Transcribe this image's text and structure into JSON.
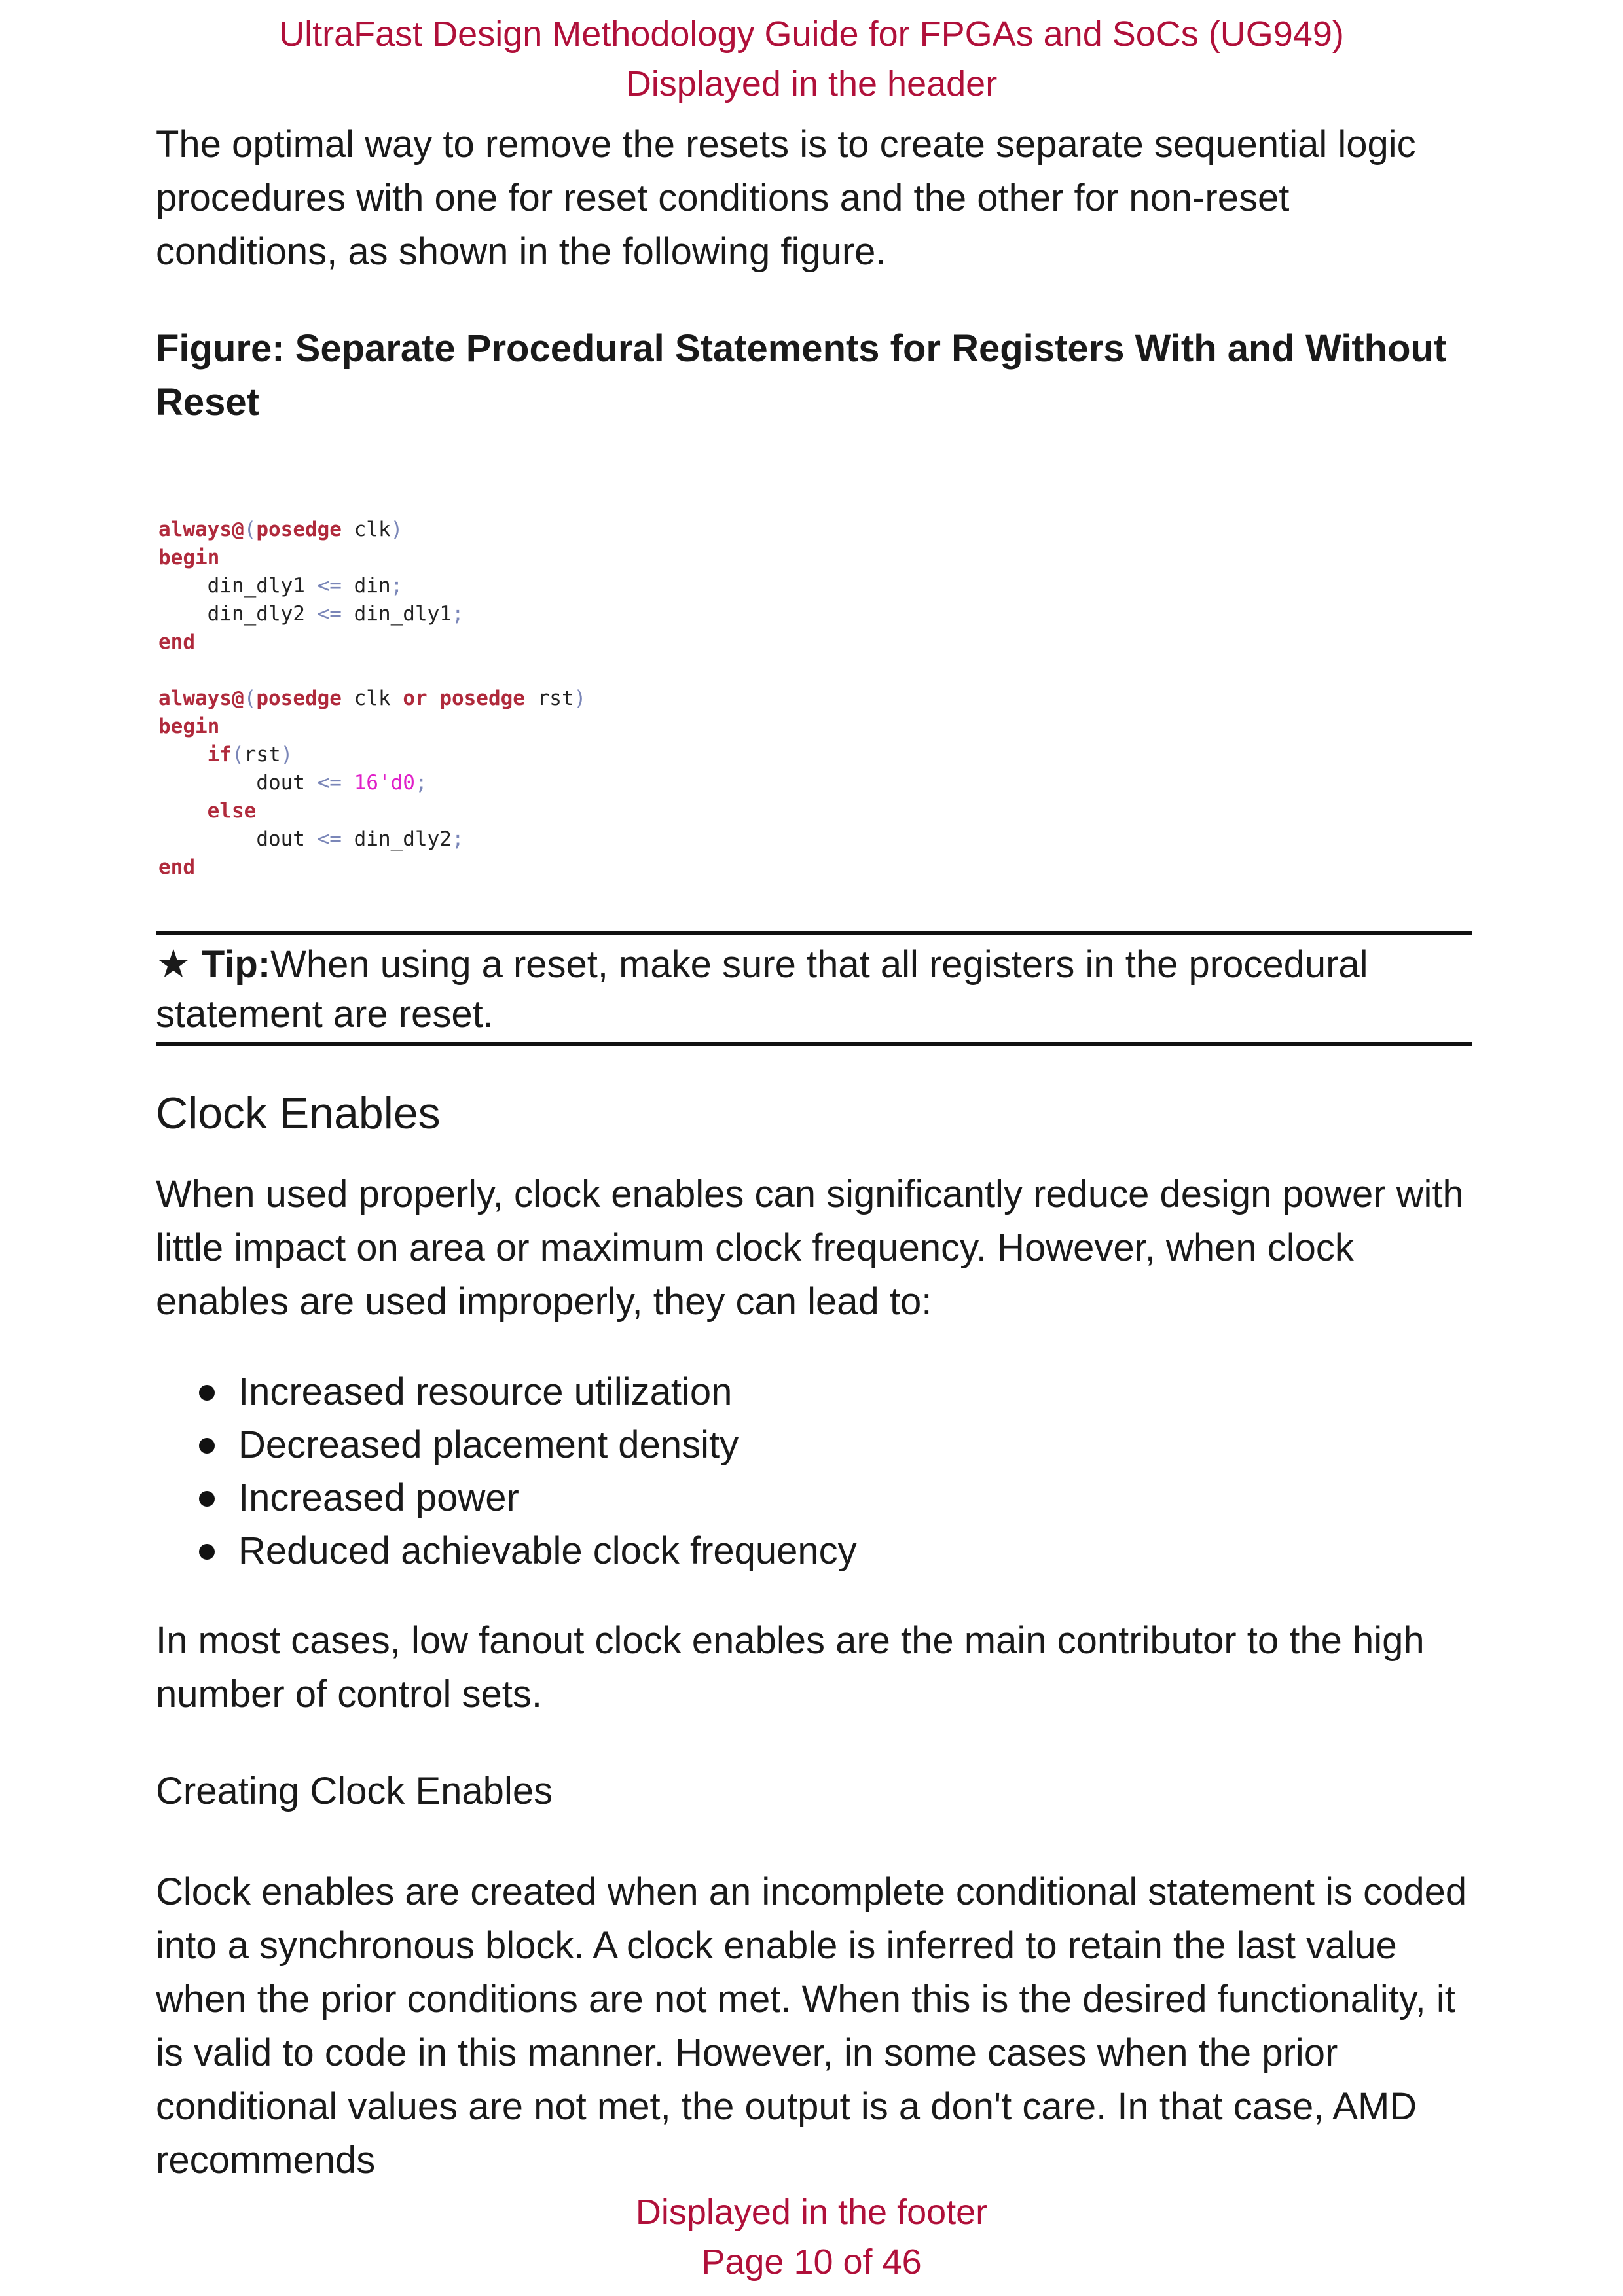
{
  "header": {
    "title": "UltraFast Design Methodology Guide for FPGAs and SoCs (UG949)",
    "subtitle": "Displayed in the header"
  },
  "intro_paragraph": "The optimal way to remove the resets is to create separate sequential logic procedures with one for reset conditions and the other for non-reset conditions, as shown in the following figure.",
  "figure": {
    "title": "Figure: Separate Procedural Statements for Registers With and Without Reset",
    "code": {
      "block1_line1_kw": "always@",
      "block1_line1_paren_open": "(",
      "block1_line1_posedge": "posedge",
      "block1_line1_sig": " clk",
      "block1_line1_paren_close": ")",
      "begin": "begin",
      "b1_assign1_lhs": "din_dly1",
      "b1_assign1_rhs": "din",
      "b1_assign2_lhs": "din_dly2",
      "b1_assign2_rhs": "din_dly1",
      "end": "end",
      "block2_sig1": " clk ",
      "block2_or": "or",
      "block2_sig2": " rst",
      "if_kw": "if",
      "if_cond": "rst",
      "dout": "dout",
      "reset_val": "16'd0",
      "else_kw": "else",
      "else_rhs": "din_dly2",
      "assign_op": "<=",
      "semicolon": ";"
    }
  },
  "tip": {
    "star": "★",
    "label": "Tip:",
    "text": "When using a reset, make sure that all registers in the procedural statement are reset."
  },
  "clock_enables": {
    "heading": "Clock Enables",
    "paragraph": "When used properly, clock enables can significantly reduce design power with little impact on area or maximum clock frequency. However, when clock enables are used improperly, they can lead to:",
    "bullets": [
      "Increased resource utilization",
      "Decreased placement density",
      "Increased power",
      "Reduced achievable clock frequency"
    ],
    "paragraph2": "In most cases, low fanout clock enables are the main contributor to the high number of control sets.",
    "subheading": "Creating Clock Enables",
    "paragraph3": "Clock enables are created when an incomplete conditional statement is coded into a synchronous block. A clock enable is inferred to retain the last value when the prior conditions are not met. When this is the desired functionality, it is valid to code in this manner. However, in some cases when the prior conditional values are not met, the output is a don't care. In that case, AMD recommends"
  },
  "footer": {
    "label": "Displayed in the footer",
    "page": "Page 10 of 46"
  },
  "colors": {
    "header_footer": "#b0103a",
    "code_keyword": "#b02a3c",
    "code_operator": "#7a86b8",
    "code_number": "#e020c8"
  }
}
